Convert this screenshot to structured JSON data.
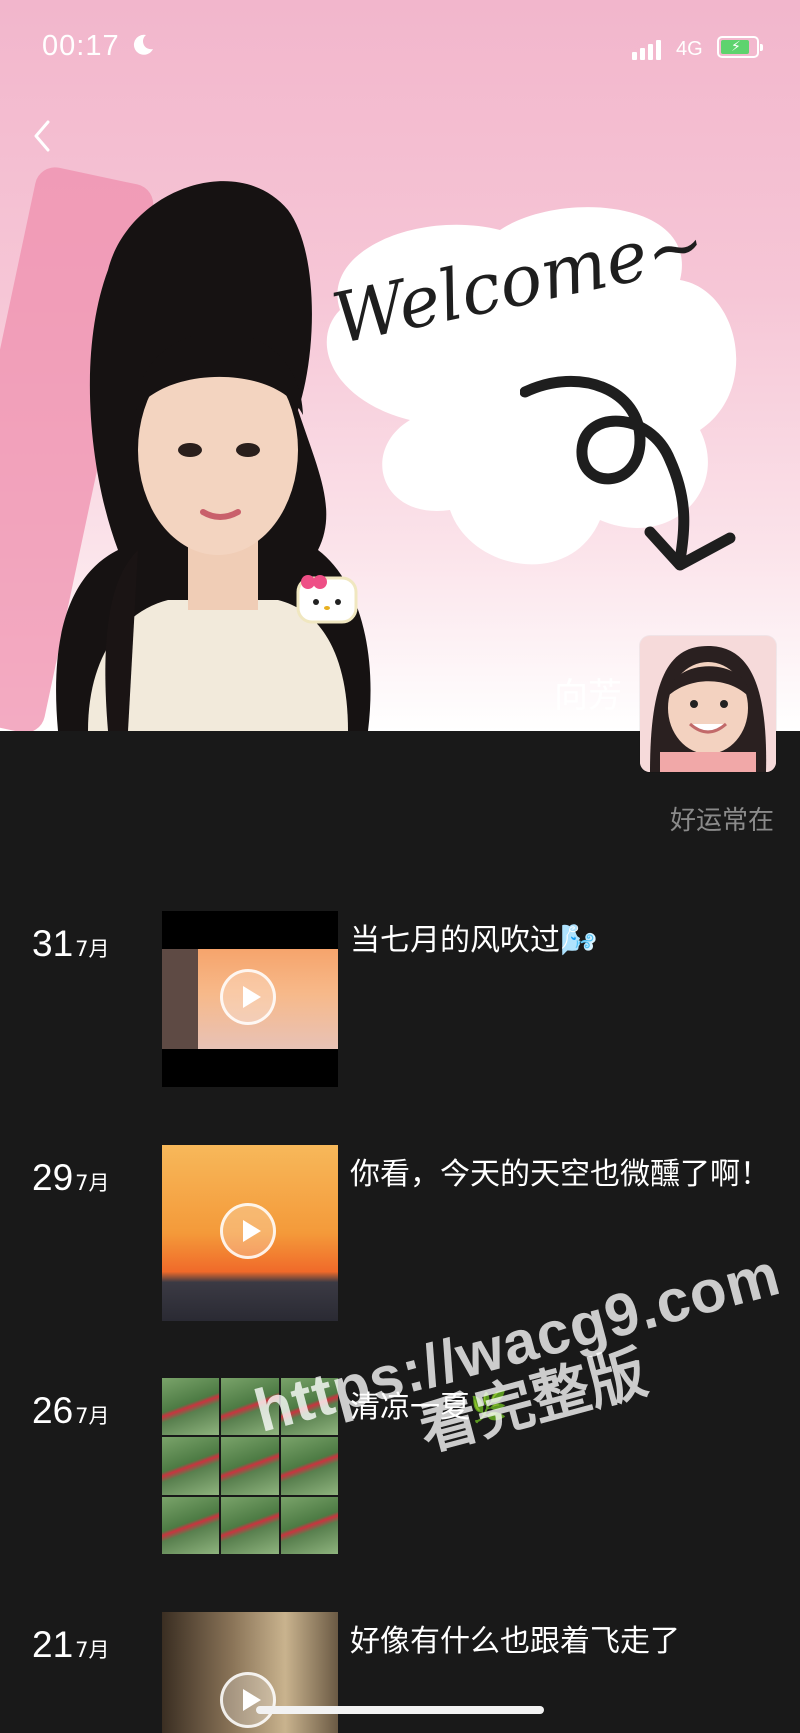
{
  "status_bar": {
    "time": "00:17",
    "network": "4G",
    "icons": [
      "moon-icon",
      "signal-icon",
      "battery-charging-icon"
    ]
  },
  "cover": {
    "welcome_text": "Welcome~",
    "back_icon": "chevron-left-icon"
  },
  "profile": {
    "name": "向芳",
    "signature": "好运常在"
  },
  "posts": [
    {
      "day": "31",
      "month": "7月",
      "caption": "当七月的风吹过🌬️",
      "type": "video"
    },
    {
      "day": "29",
      "month": "7月",
      "caption": "你看，今天的天空也微醺了啊！",
      "type": "video"
    },
    {
      "day": "26",
      "month": "7月",
      "caption": "清凉一夏🌿",
      "type": "photo-grid"
    },
    {
      "day": "21",
      "month": "7月",
      "caption": "好像有什么也跟着飞走了",
      "type": "video"
    }
  ],
  "watermark": {
    "line1": "https://wacg9.com",
    "line2": "看完整版"
  },
  "colors": {
    "background": "#191919",
    "cover_pink": "#f2b6cc",
    "accent_green": "#5ed36e"
  }
}
